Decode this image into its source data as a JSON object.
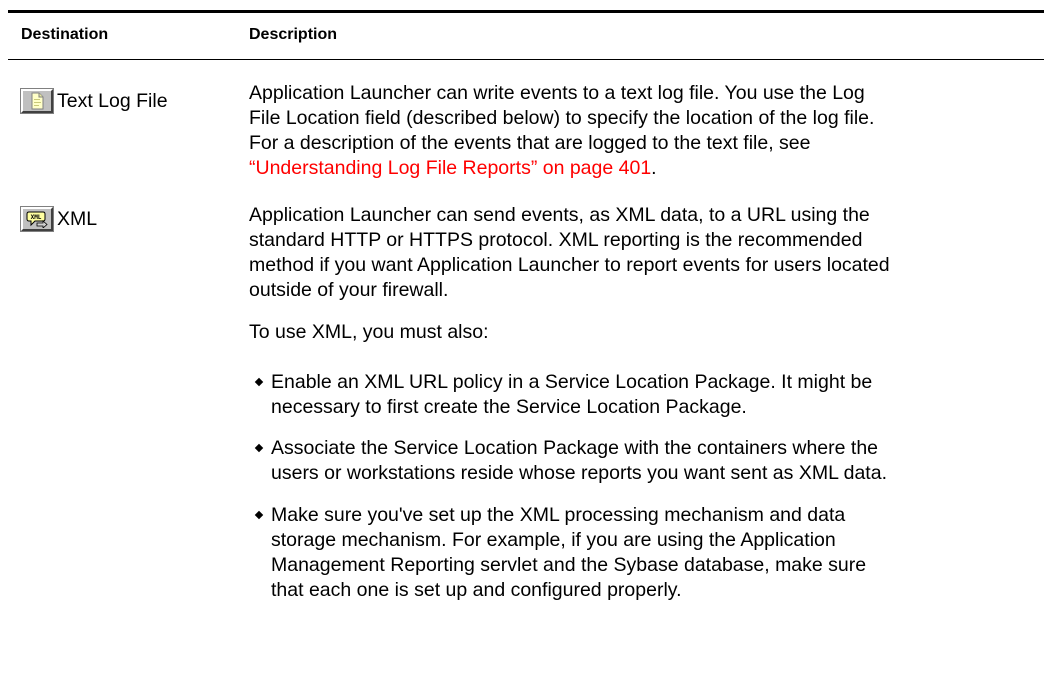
{
  "headers": {
    "destination": "Destination",
    "description": "Description"
  },
  "rows": [
    {
      "icon": "text-log-file-icon",
      "destination": "Text Log File",
      "description_lines": [
        "Application Launcher can write events to a text log file. You use the Log",
        "File Location field (described below) to specify the location of the log file.",
        "For a description of the events that are logged to the text file, see"
      ],
      "link_text": "“Understanding Log File Reports” on page 401",
      "link_suffix": "."
    },
    {
      "icon": "xml-icon",
      "destination": "XML",
      "description_lines": [
        "Application Launcher can send events, as XML data, to a URL using the",
        "standard HTTP or HTTPS protocol. XML reporting is the recommended",
        "method if you want Application Launcher to report events for users located",
        "outside of your firewall."
      ],
      "intro": "To use XML, you must also:",
      "bullets": [
        {
          "lines": [
            "Enable an XML URL policy in a Service Location Package. It might be",
            "necessary to first create the Service Location Package."
          ]
        },
        {
          "lines": [
            "Associate the Service Location Package with the containers where the",
            "users or workstations reside whose reports you want sent as XML data."
          ]
        },
        {
          "lines": [
            "Make sure you've set up the XML processing mechanism and data",
            "storage mechanism. For example, if you are using the Application",
            "Management Reporting servlet and the Sybase database, make sure",
            "that each one is set up and configured properly."
          ]
        }
      ]
    }
  ],
  "colors": {
    "link": "#ff0000",
    "rule": "#000000",
    "icon_face": "#c0c0c0"
  }
}
